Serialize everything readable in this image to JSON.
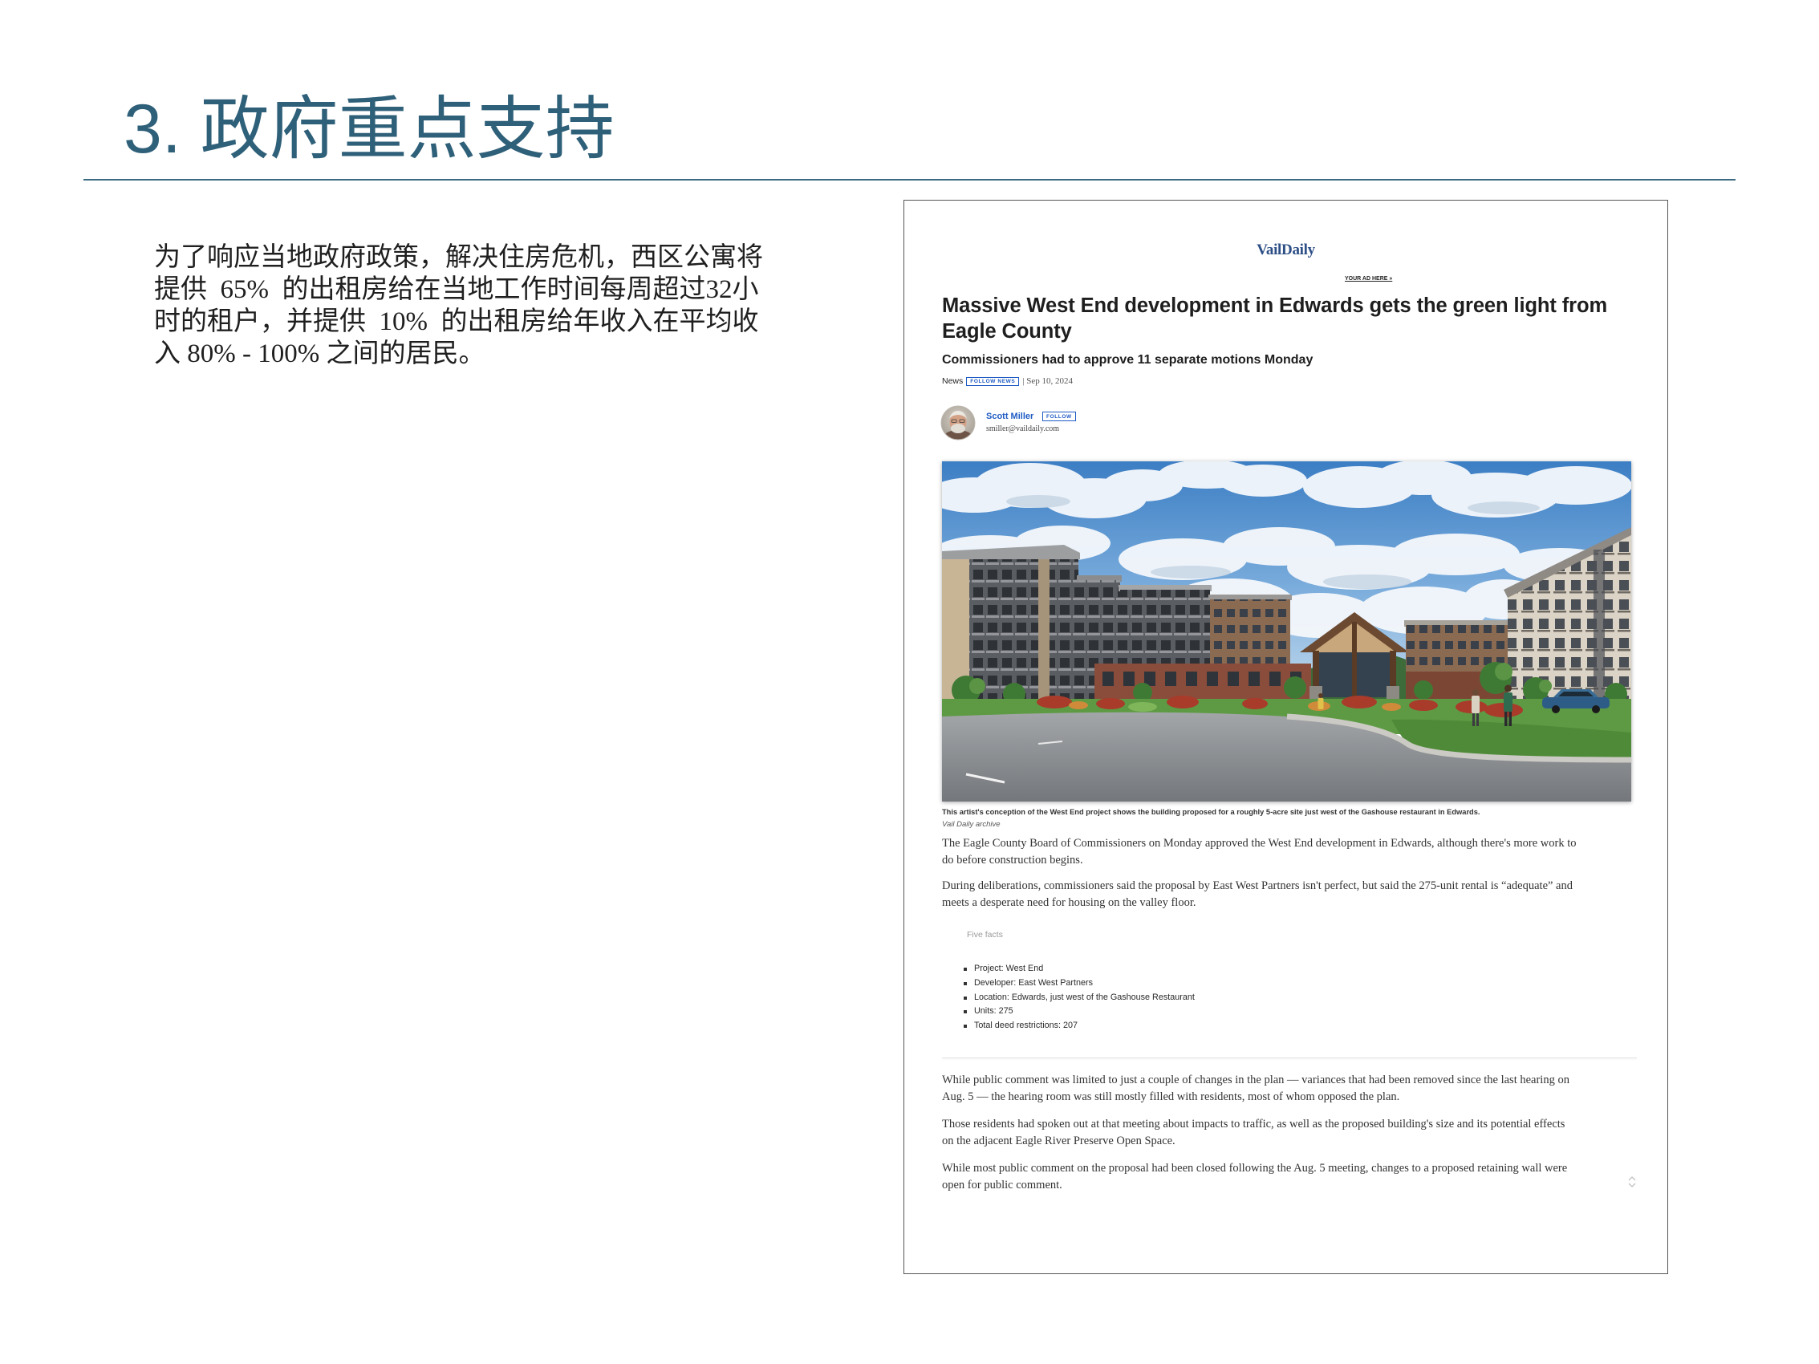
{
  "slide": {
    "title": "3. 政府重点支持",
    "body_lines": [
      "为了响应当地政府政策，解决住房危机，西区公寓将",
      "提供  65%  的出租房给在当地工作时间每周超过32小",
      "时的租户，并提供  10%  的出租房给年收入在平均收",
      "入 80% - 100% 之间的居民。"
    ]
  },
  "article": {
    "publication": "VailDaily",
    "ad_link": "YOUR AD HERE »",
    "headline_lines": [
      "Massive West End development in Edwards gets the green light from",
      "Eagle County"
    ],
    "subheadline": "Commissioners had to approve 11 separate motions Monday",
    "section": "News",
    "follow_section": "FOLLOW NEWS",
    "date": "| Sep 10, 2024",
    "author": {
      "name": "Scott Miller",
      "follow": "FOLLOW",
      "email": "smiller@vaildaily.com"
    },
    "image": {
      "caption": "This artist's conception of the West End project shows the building proposed for a roughly 5-acre site just west of the Gashouse restaurant in Edwards.",
      "credit": "Vail Daily archive"
    },
    "intro_paragraphs": [
      [
        "The Eagle County Board of Commissioners on Monday approved the West End development in Edwards, although there's more work to",
        "do before construction begins."
      ],
      [
        "During deliberations, commissioners said the proposal by East West Partners isn't perfect, but said the 275-unit rental is “adequate” and",
        "meets a desperate need for housing on the valley floor."
      ]
    ],
    "facts": {
      "heading": "Five facts",
      "items": [
        "Project: West End",
        "Developer: East West Partners",
        "Location: Edwards, just west of the Gashouse Restaurant",
        "Units: 275",
        "Total deed restrictions: 207"
      ]
    },
    "body_paragraphs": [
      [
        "While public comment was limited to just a couple of changes in the plan — variances that had been removed since the last hearing on",
        "Aug. 5 — the hearing room was still mostly filled with residents, most of whom opposed the plan."
      ],
      [
        "Those residents had spoken out at that meeting about impacts to traffic, as well as the proposed building's size and its potential effects",
        "on the adjacent Eagle River Preserve Open Space."
      ],
      [
        "While most public comment on the proposal had been closed following the Aug. 5 meeting, changes to a proposed retaining wall were",
        "open for public comment."
      ]
    ]
  },
  "icons": {
    "author_avatar": "author-avatar-photo",
    "scroll": "scroll-arrows-icon"
  },
  "colors": {
    "title": "#2f6079",
    "rule": "#3b6b82",
    "link_blue": "#1f5bc4",
    "headline": "#1e1e1e",
    "body_text": "#333333"
  }
}
